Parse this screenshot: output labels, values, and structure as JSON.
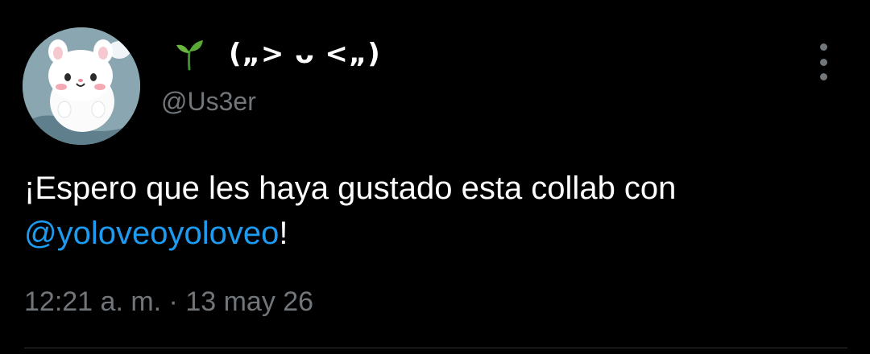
{
  "user": {
    "display_name": "(„> ᴗ <„)",
    "handle": "@Us3er",
    "name_emoji_icon": "seedling-icon",
    "avatar_icon": "hamster-avatar"
  },
  "menu": {
    "more_icon": "more-vertical-icon"
  },
  "tweet": {
    "text_before": "¡Espero que les haya gustado esta collab con ",
    "mention": "@yoloveoyoloveo",
    "text_after": "!"
  },
  "meta": {
    "time": "12:21 a. m.",
    "separator": " · ",
    "date": "13 may 26"
  },
  "colors": {
    "background": "#000000",
    "text_primary": "#ffffff",
    "text_secondary": "#71767b",
    "link": "#1d9bf0",
    "divider": "#2f3336"
  }
}
